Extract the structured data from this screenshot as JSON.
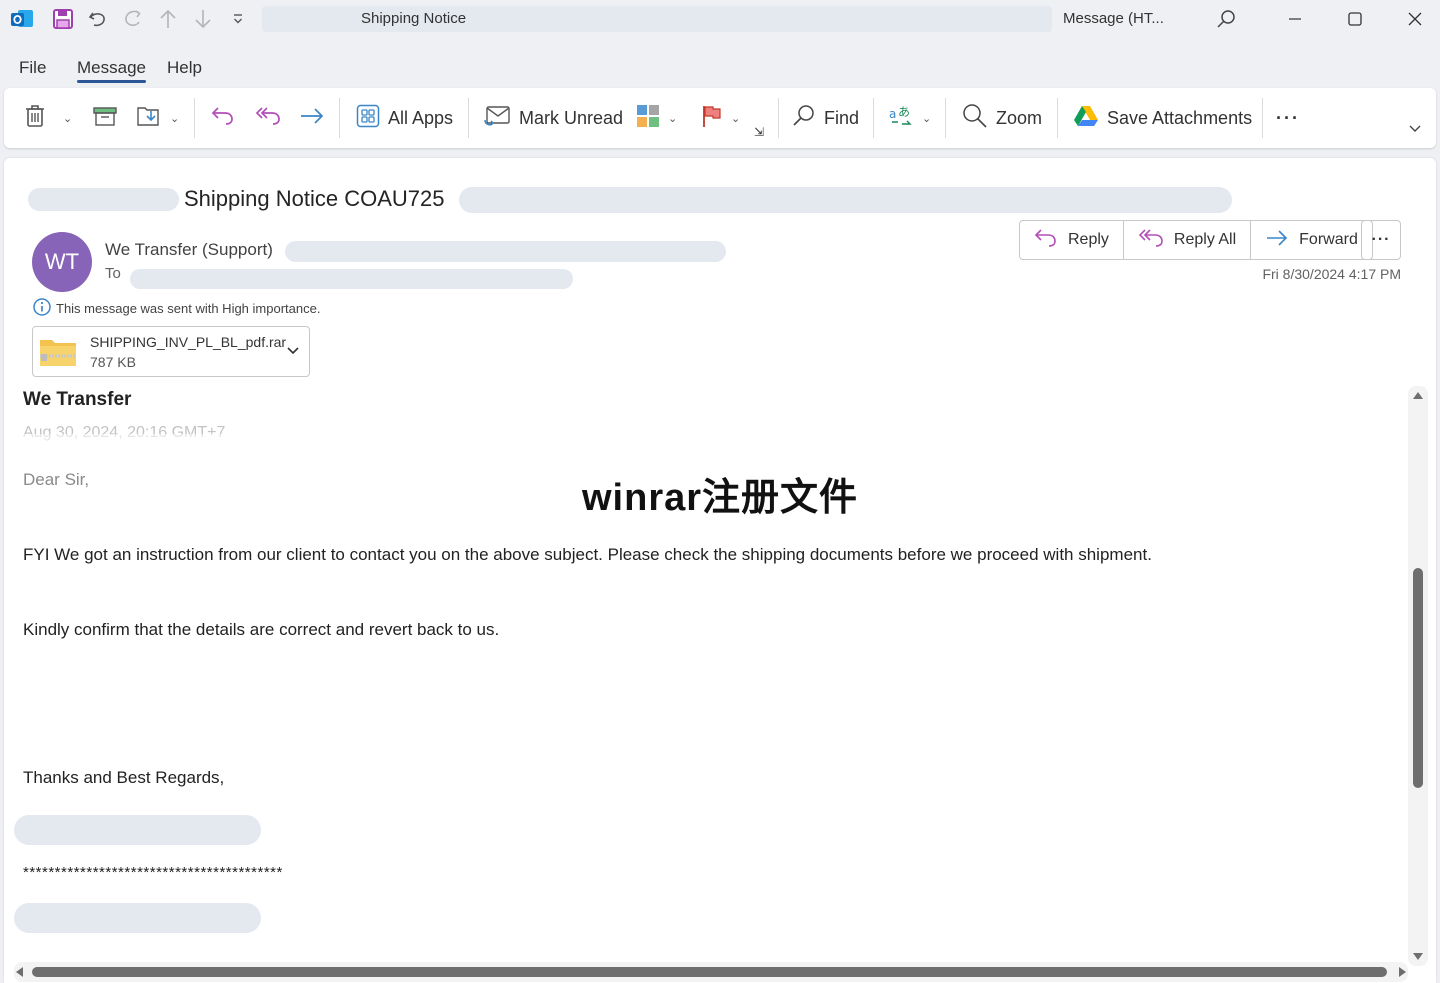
{
  "titlebar": {
    "title": "Shipping Notice",
    "window_label": "Message (HT..."
  },
  "menu": {
    "tabs": [
      {
        "label": "File",
        "active": false
      },
      {
        "label": "Message",
        "active": true
      },
      {
        "label": "Help",
        "active": false
      }
    ]
  },
  "ribbon": {
    "all_apps": "All Apps",
    "mark_unread": "Mark Unread",
    "find": "Find",
    "zoom": "Zoom",
    "save_attachments": "Save Attachments",
    "more": "···"
  },
  "message": {
    "subject": "Shipping Notice COAU725",
    "sender_initials": "WT",
    "sender_name": "We Transfer (Support)",
    "to_label": "To",
    "received": "Fri 8/30/2024 4:17 PM",
    "importance_notice": "This message was sent with High importance.",
    "actions": {
      "reply": "Reply",
      "reply_all": "Reply All",
      "forward": "Forward",
      "more": "···"
    },
    "attachment": {
      "name": "SHIPPING_INV_PL_BL_pdf.rar",
      "size": "787 KB"
    }
  },
  "body": {
    "from": "We Transfer",
    "date": "Aug 30, 2024, 20:16 GMT+7",
    "greeting": "Dear Sir,",
    "paragraph1": "FYI We got an instruction from our client to contact you on the above subject. Please check the shipping documents before we proceed with shipment.",
    "paragraph2": "Kindly confirm that the details are correct and revert back to us.",
    "closing": "Thanks and Best Regards,",
    "separator": "*****************************************"
  },
  "overlay": {
    "watermark": "winrar注册文件"
  },
  "colors": {
    "avatar": "#8764b8",
    "active_tab_underline": "#2b5797",
    "reply_icon": "#b24fb8",
    "forward_icon": "#3a86c8"
  }
}
